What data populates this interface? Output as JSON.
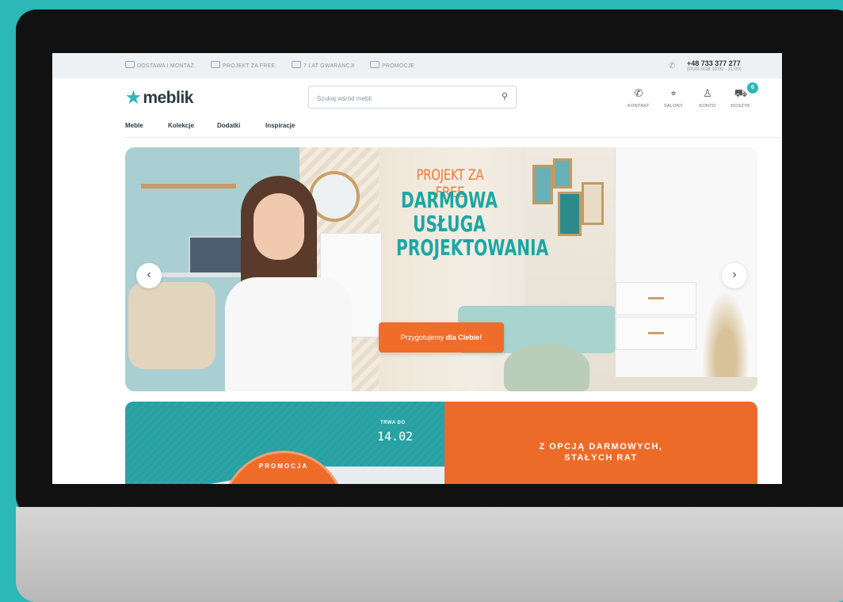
{
  "topbar": {
    "items": [
      "DOSTAWA I MONTAŻ",
      "PROJEKT ZA FREE",
      "7 LAT GWARANCJI",
      "PROMOCJE"
    ],
    "phone": "+48 733 377 277",
    "hours": "(PON-SOB 10:00 - 21:00)"
  },
  "brand": {
    "name": "meblik"
  },
  "search": {
    "placeholder": "Szukaj wśród mebli"
  },
  "header_icons": {
    "contact": "KONTAKT",
    "stores": "SALONY",
    "account": "KONTO",
    "cart": "KOSZYK",
    "cart_count": "0"
  },
  "nav": {
    "items": [
      "Meble",
      "Kolekcje",
      "Dodatki",
      "Inspiracje"
    ]
  },
  "hero": {
    "kicker": "PROJEKT ZA FREE",
    "title_line1": "DARMOWA",
    "title_line2": "USŁUGA",
    "title_line3": "PROJEKTOWANIA",
    "cta_normal": "Przygotujemy ",
    "cta_bold": "dla Ciebie!"
  },
  "promo": {
    "lasts_label": "TRWA DO",
    "date": "14.02",
    "badge_label": "PROMOCJA",
    "right_line1": "Z OPCJĄ DARMOWYCH,",
    "right_line2": "STAŁYCH RAT"
  },
  "colors": {
    "accent": "#2bb8b6",
    "orange": "#ef6c2a",
    "teal_dark": "#1aa7a4"
  }
}
